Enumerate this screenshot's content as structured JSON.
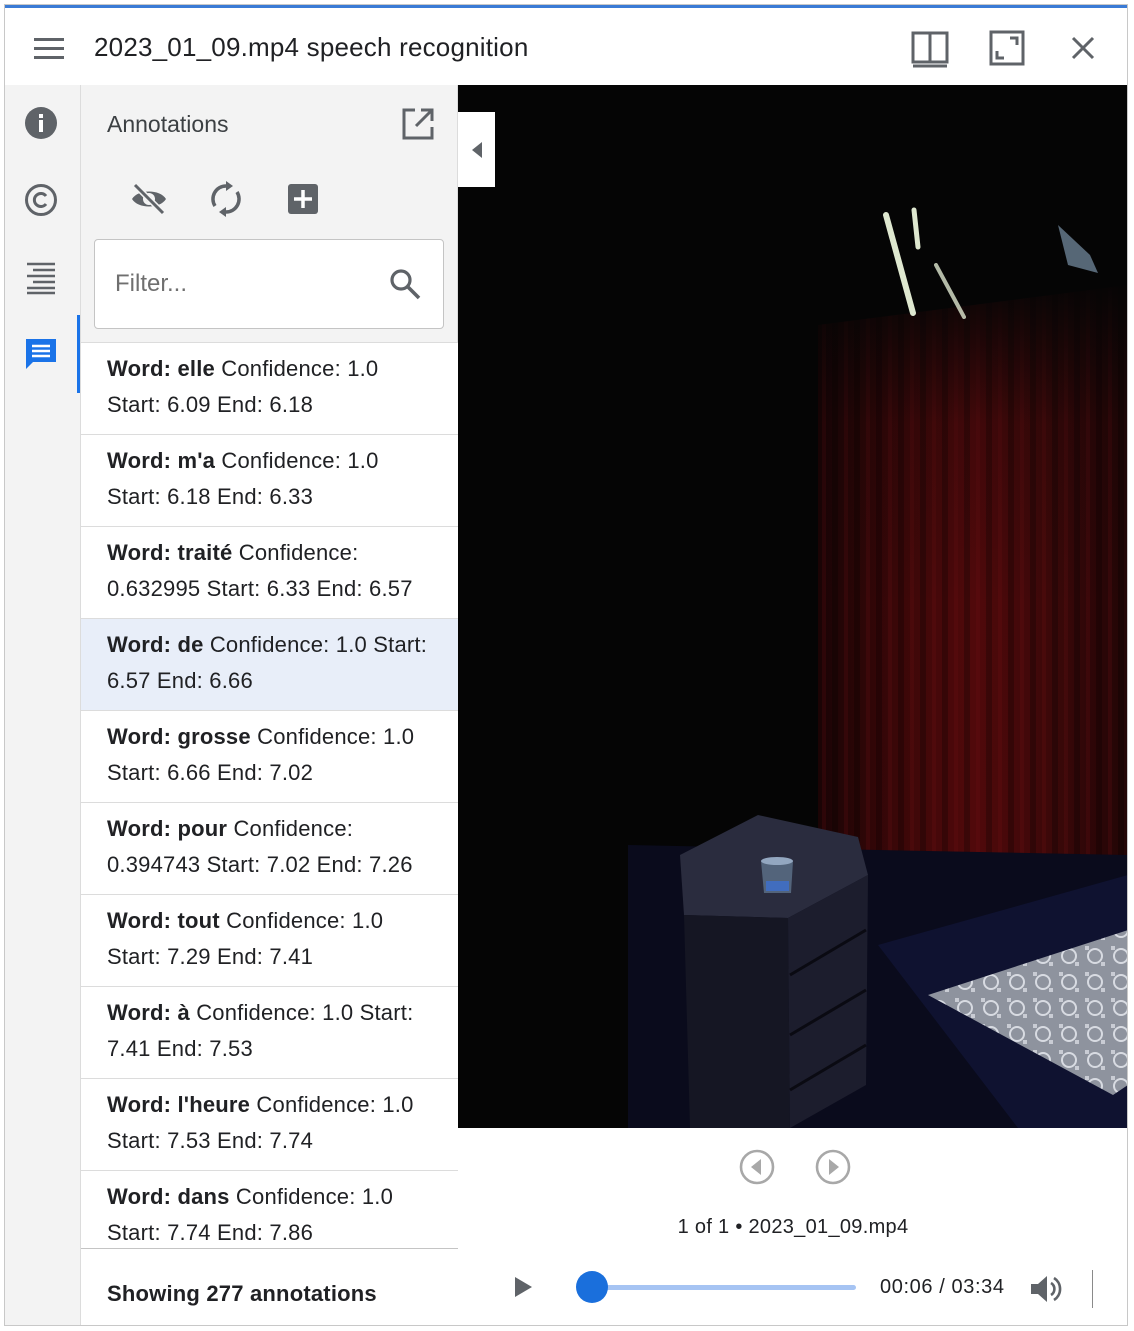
{
  "window": {
    "title": "2023_01_09.mp4 speech recognition",
    "menu_icon": "hamburger-menu-icon",
    "actions": [
      "split-view-icon",
      "fullscreen-icon",
      "close-icon"
    ]
  },
  "rail": {
    "items": [
      {
        "icon": "info-icon",
        "active": false
      },
      {
        "icon": "copyright-icon",
        "active": false
      },
      {
        "icon": "text-lines-icon",
        "active": false
      },
      {
        "icon": "comment-icon",
        "active": true
      }
    ],
    "accent": "#1a73e8"
  },
  "annotations_panel": {
    "title": "Annotations",
    "tools": [
      "visibility-off-icon",
      "sync-icon",
      "add-box-icon"
    ],
    "filter_placeholder": "Filter...",
    "items": [
      {
        "word": "elle",
        "rest": " Confidence: 1.0 Start: 6.09 End: 6.18",
        "selected": false
      },
      {
        "word": "m'a",
        "rest": " Confidence: 1.0 Start: 6.18 End: 6.33",
        "selected": false
      },
      {
        "word": "traité",
        "rest": " Confidence: 0.632995 Start: 6.33 End: 6.57",
        "selected": false
      },
      {
        "word": "de",
        "rest": " Confidence: 1.0 Start: 6.57 End: 6.66",
        "selected": true
      },
      {
        "word": "grosse",
        "rest": " Confidence: 1.0 Start: 6.66 End: 7.02",
        "selected": false
      },
      {
        "word": "pour",
        "rest": " Confidence: 0.394743 Start: 7.02 End: 7.26",
        "selected": false
      },
      {
        "word": "tout",
        "rest": " Confidence: 1.0 Start: 7.29 End: 7.41",
        "selected": false
      },
      {
        "word": "à",
        "rest": " Confidence: 1.0 Start: 7.41 End: 7.53",
        "selected": false
      },
      {
        "word": "l'heure",
        "rest": " Confidence: 1.0 Start: 7.53 End: 7.74",
        "selected": false
      },
      {
        "word": "dans",
        "rest": " Confidence: 1.0 Start: 7.74 End: 7.86",
        "selected": false
      }
    ],
    "word_prefix": "Word: ",
    "footer": "Showing 277 annotations"
  },
  "player": {
    "page_info": "1 of 1 • 2023_01_09.mp4",
    "time": "00:06 / 03:34",
    "progress": 0.028,
    "colors": {
      "thumb": "#1a6fdc",
      "track": "#a6c4f3"
    }
  }
}
